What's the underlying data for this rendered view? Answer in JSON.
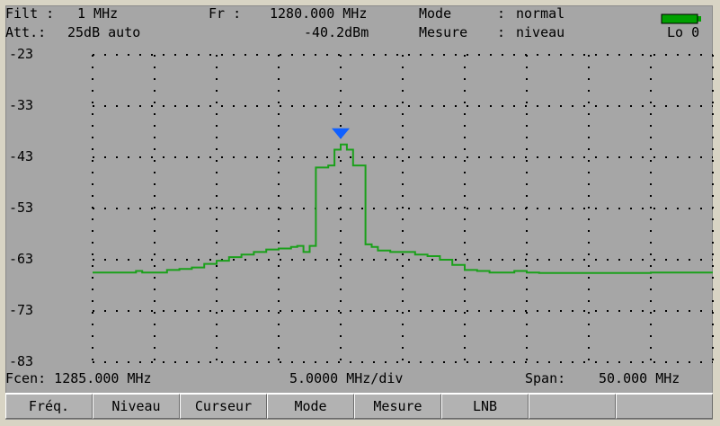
{
  "header": {
    "filt_label": "Filt :",
    "filt_value": "1 MHz",
    "att_label": "Att.:",
    "att_value": "25dB auto",
    "fr_label": "Fr :",
    "fr_value": "1280.000 MHz",
    "level_value": "-40.2dBm",
    "mode_label": "Mode",
    "mode_sep": ":",
    "mode_value": "normal",
    "mesure_label": "Mesure",
    "mesure_sep": ":",
    "mesure_value": "niveau",
    "battery_label": "Lo 0"
  },
  "footer": {
    "fcen": "Fcen: 1285.000 MHz",
    "div": "5.0000 MHz/div",
    "span_label": "Span:",
    "span_value": "50.000 MHz"
  },
  "menu": [
    "Fréq.",
    "Niveau",
    "Curseur",
    "Mode",
    "Mesure",
    "LNB",
    "",
    ""
  ],
  "colors": {
    "trace": "#1aa01a",
    "marker": "#1060ff",
    "battery": "#00a000",
    "grid_dot": "#000000"
  },
  "chart_data": {
    "type": "line",
    "ytick_labels": [
      "-23",
      "-33",
      "-43",
      "-53",
      "-63",
      "-73",
      "-83"
    ],
    "ylim": [
      -83,
      -23
    ],
    "xlim": [
      1260,
      1310
    ],
    "x_unit": "MHz",
    "y_unit": "dBm",
    "marker_x": 1280,
    "series": [
      {
        "x": [
          1260,
          1262,
          1263.5,
          1264,
          1265,
          1266,
          1267,
          1268,
          1269,
          1270,
          1271,
          1272,
          1273,
          1274,
          1275,
          1276,
          1276.5,
          1277,
          1277.5,
          1278,
          1279,
          1279.5,
          1280,
          1280.5,
          1281,
          1281.5,
          1282,
          1282.5,
          1283,
          1284,
          1285,
          1286,
          1287,
          1288,
          1289,
          1290,
          1291,
          1292,
          1293,
          1294,
          1295,
          1296,
          1298,
          1300,
          1305,
          1310
        ],
        "y": [
          -65.5,
          -65.5,
          -65.2,
          -65.5,
          -65.5,
          -65,
          -64.8,
          -64.5,
          -63.8,
          -63.2,
          -62.5,
          -62,
          -61.5,
          -61,
          -60.8,
          -60.5,
          -60.3,
          -61.5,
          -60.3,
          -45,
          -44.6,
          -41.5,
          -40.5,
          -41.5,
          -44.6,
          -44.6,
          -60,
          -60.5,
          -61.2,
          -61.5,
          -61.5,
          -62,
          -62.3,
          -63,
          -64,
          -65,
          -65.2,
          -65.5,
          -65.5,
          -65.2,
          -65.5,
          -65.6,
          -65.6,
          -65.6,
          -65.5,
          -65.5
        ]
      }
    ]
  }
}
